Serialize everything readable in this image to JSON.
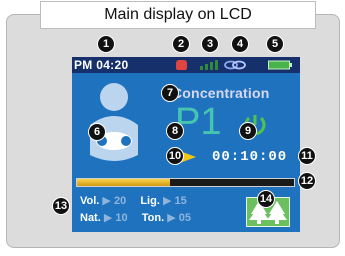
{
  "title": "Main display on LCD",
  "status_bar": {
    "time": "PM 04:20",
    "icons": [
      "alarm-icon",
      "signal-icon",
      "link-icon",
      "battery-icon"
    ]
  },
  "mode": "Concentration",
  "program": "P1",
  "timer": "00:10:00",
  "progress": 0.43,
  "settings": {
    "vol_label": "Vol.",
    "vol_value": "20",
    "lig_label": "Lig.",
    "lig_value": "15",
    "nat_label": "Nat.",
    "nat_value": "10",
    "ton_label": "Ton.",
    "ton_value": "05"
  },
  "callouts": [
    "1",
    "2",
    "3",
    "4",
    "5",
    "6",
    "7",
    "8",
    "9",
    "10",
    "11",
    "12",
    "13",
    "14"
  ],
  "colors": {
    "screen": "#1f73be",
    "status_bar": "#15306b",
    "program_text": "#47c4b0",
    "progress": "#e2b428",
    "tree_button": "#6cc060"
  }
}
